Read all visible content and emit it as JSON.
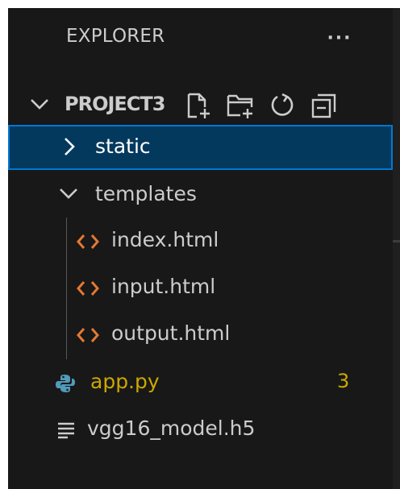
{
  "explorer": {
    "title": "EXPLORER",
    "more_actions": "···",
    "project_name": "PROJECT3"
  },
  "toolbar": {
    "icons": [
      "new-file-icon",
      "new-folder-icon",
      "refresh-icon",
      "collapse-all-icon"
    ]
  },
  "tree": {
    "folders": [
      {
        "name": "static",
        "expanded": false,
        "selected": true
      },
      {
        "name": "templates",
        "expanded": true,
        "selected": false
      }
    ],
    "template_files": [
      {
        "name": "index.html",
        "icon": "html-code-icon"
      },
      {
        "name": "input.html",
        "icon": "html-code-icon"
      },
      {
        "name": "output.html",
        "icon": "html-code-icon"
      }
    ],
    "root_files": [
      {
        "name": "app.py",
        "icon": "python-icon",
        "problems_badge": "3"
      },
      {
        "name": "vgg16_model.h5",
        "icon": "text-file-icon"
      }
    ]
  },
  "colors": {
    "background": "#181818",
    "selected_background": "#04395e",
    "focus_border": "#0078d4",
    "text": "#cccccc",
    "warning": "#cca700",
    "html_icon": "#e37933",
    "python_icon": "#519aba"
  }
}
